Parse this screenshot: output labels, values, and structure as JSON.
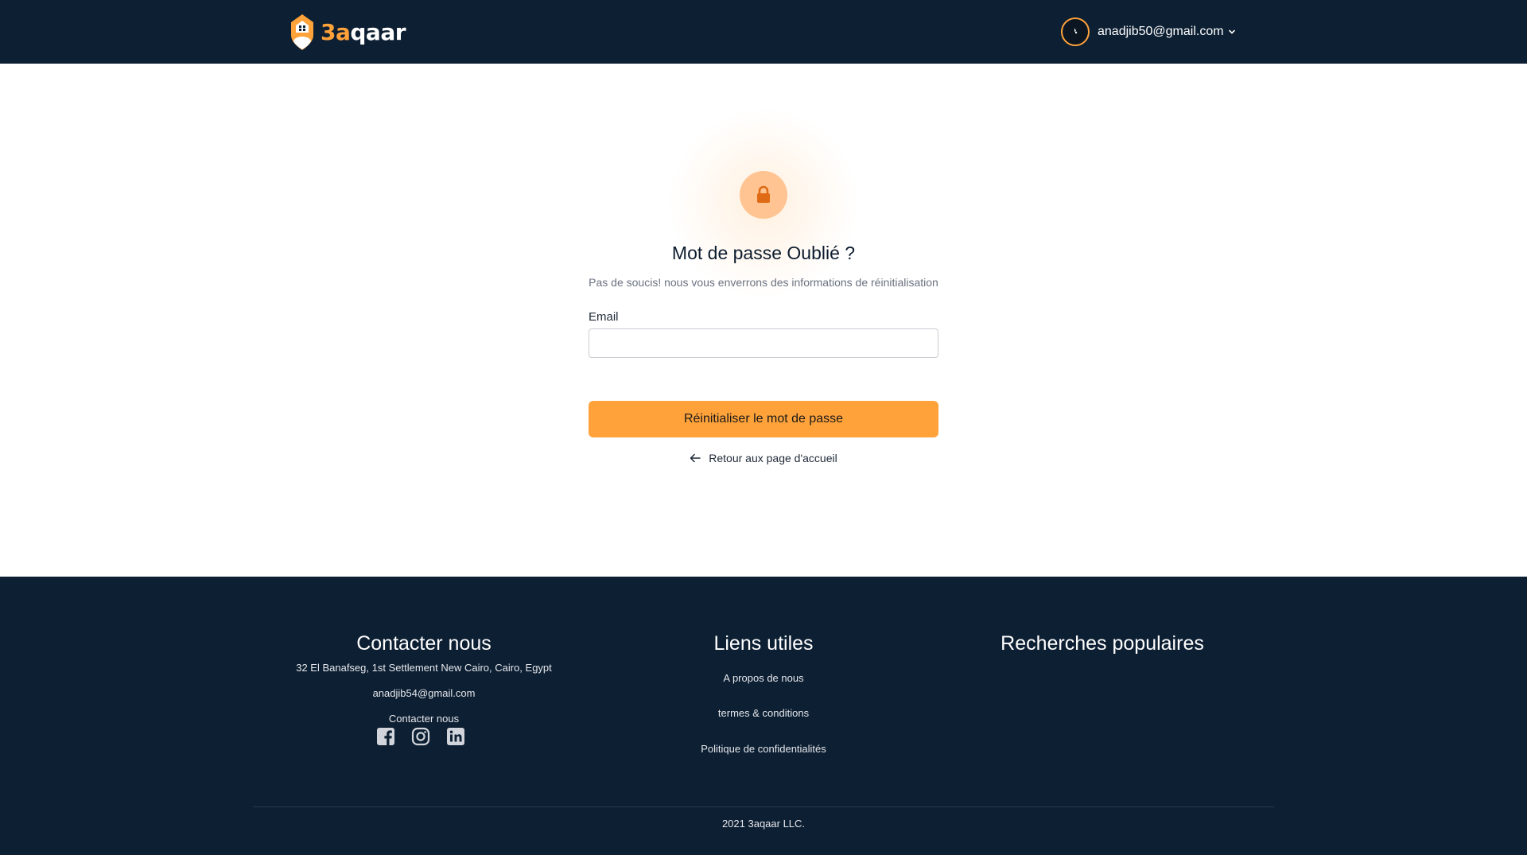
{
  "header": {
    "logo": {
      "prefix": "3a",
      "suffix": "qaar"
    },
    "user_email": "anadjib50@gmail.com"
  },
  "main": {
    "title": "Mot de passe Oublié ?",
    "subtitle": "Pas de soucis! nous vous enverrons des informations de réinitialisation",
    "email_label": "Email",
    "email_value": "",
    "reset_button": "Réinitialiser le mot de passe",
    "back_link": "Retour aux page d'accueil"
  },
  "footer": {
    "contact": {
      "title": "Contacter nous",
      "address": "32 El Banafseg, 1st Settlement New Cairo, Cairo, Egypt",
      "email": "anadjib54@gmail.com",
      "link": "Contacter nous"
    },
    "useful_links": {
      "title": "Liens utiles",
      "items": [
        "A propos de nous",
        "termes & conditions",
        "Politique de confidentialités"
      ]
    },
    "popular": {
      "title": "Recherches populaires"
    },
    "socials": [
      "facebook-icon",
      "instagram-icon",
      "linkedin-icon"
    ],
    "copyright": "2021 3aqaar LLC."
  },
  "colors": {
    "navy": "#0d1f33",
    "accent": "#ffa23a",
    "lock_bg": "#ffc491",
    "lock_icon": "#e06b16"
  }
}
